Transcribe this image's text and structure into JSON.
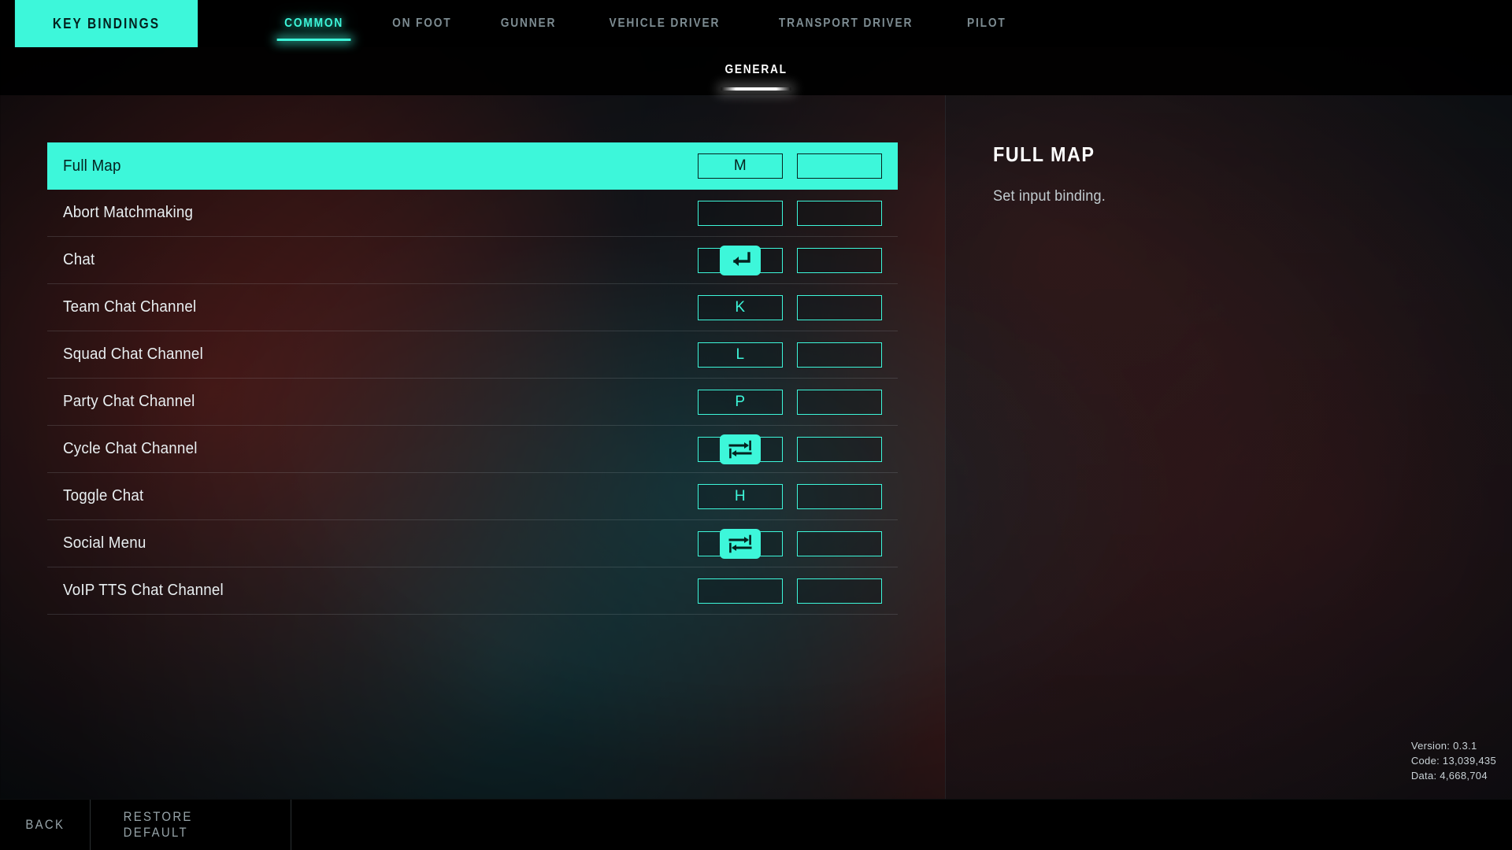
{
  "header": {
    "title": "KEY BINDINGS",
    "tabs": [
      {
        "label": "COMMON",
        "active": true
      },
      {
        "label": "ON FOOT",
        "active": false
      },
      {
        "label": "GUNNER",
        "active": false
      },
      {
        "label": "VEHICLE DRIVER",
        "active": false
      },
      {
        "label": "TRANSPORT DRIVER",
        "active": false
      },
      {
        "label": "PILOT",
        "active": false
      }
    ]
  },
  "subtab": {
    "label": "GENERAL"
  },
  "accent_color": "#3df7da",
  "bindings": [
    {
      "name": "Full Map",
      "primary": "M",
      "primary_glyph": "",
      "secondary": "",
      "selected": true
    },
    {
      "name": "Abort Matchmaking",
      "primary": "",
      "primary_glyph": "",
      "secondary": "",
      "selected": false
    },
    {
      "name": "Chat",
      "primary": "",
      "primary_glyph": "enter-key",
      "secondary": "",
      "selected": false
    },
    {
      "name": "Team Chat Channel",
      "primary": "K",
      "primary_glyph": "",
      "secondary": "",
      "selected": false
    },
    {
      "name": "Squad Chat Channel",
      "primary": "L",
      "primary_glyph": "",
      "secondary": "",
      "selected": false
    },
    {
      "name": "Party Chat Channel",
      "primary": "P",
      "primary_glyph": "",
      "secondary": "",
      "selected": false
    },
    {
      "name": "Cycle Chat Channel",
      "primary": "",
      "primary_glyph": "tab-key",
      "secondary": "",
      "selected": false
    },
    {
      "name": "Toggle Chat",
      "primary": "H",
      "primary_glyph": "",
      "secondary": "",
      "selected": false
    },
    {
      "name": "Social Menu",
      "primary": "",
      "primary_glyph": "tab-key",
      "secondary": "",
      "selected": false
    },
    {
      "name": "VoIP TTS Chat Channel",
      "primary": "",
      "primary_glyph": "",
      "secondary": "",
      "selected": false
    }
  ],
  "detail": {
    "title": "FULL MAP",
    "description": "Set input binding."
  },
  "version_info": {
    "version": "Version: 0.3.1",
    "code": "Code: 13,039,435",
    "data": "Data: 4,668,704"
  },
  "footer": {
    "back_label": "BACK",
    "restore_label": "RESTORE DEFAULT"
  }
}
